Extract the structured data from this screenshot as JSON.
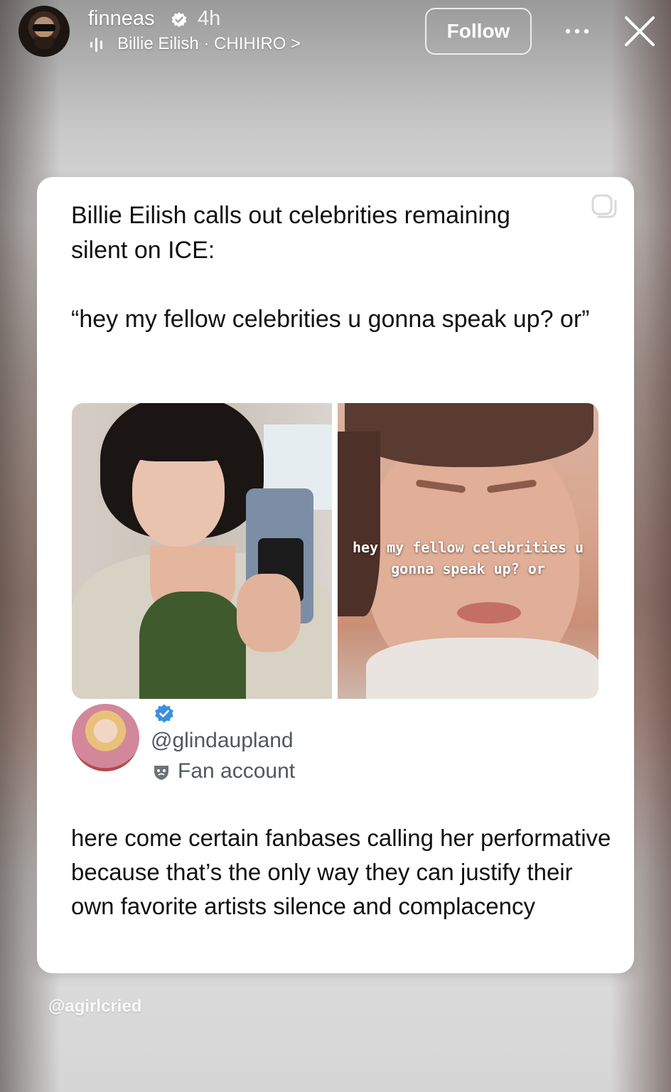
{
  "story": {
    "username": "finneas",
    "time": "4h",
    "audio": "Billie Eilish · CHIHIRO >",
    "follow_label": "Follow",
    "watermark": "@agirlcried"
  },
  "post": {
    "headline": "Billie Eilish calls out celebrities remaining silent on ICE:",
    "quote": "“hey my fellow celebrities u gonna speak up? or”",
    "image_caption": "hey my fellow celebrities u gonna speak up? or",
    "handle": "@glindaupland",
    "account_label": "Fan account",
    "body": "here come certain fanbases calling her performative because that’s the only way they can justify their own favorite artists silence and complacency"
  },
  "icons": {
    "verified": "verified-icon",
    "audio": "audio-bars-icon",
    "more": "more-icon",
    "close": "close-icon",
    "copy": "copy-icon",
    "badge": "blue-verified-icon",
    "mask": "mask-icon"
  },
  "colors": {
    "badge_blue": "#3b8fe0",
    "card_bg": "#ffffff",
    "handle_gray": "#505760"
  }
}
